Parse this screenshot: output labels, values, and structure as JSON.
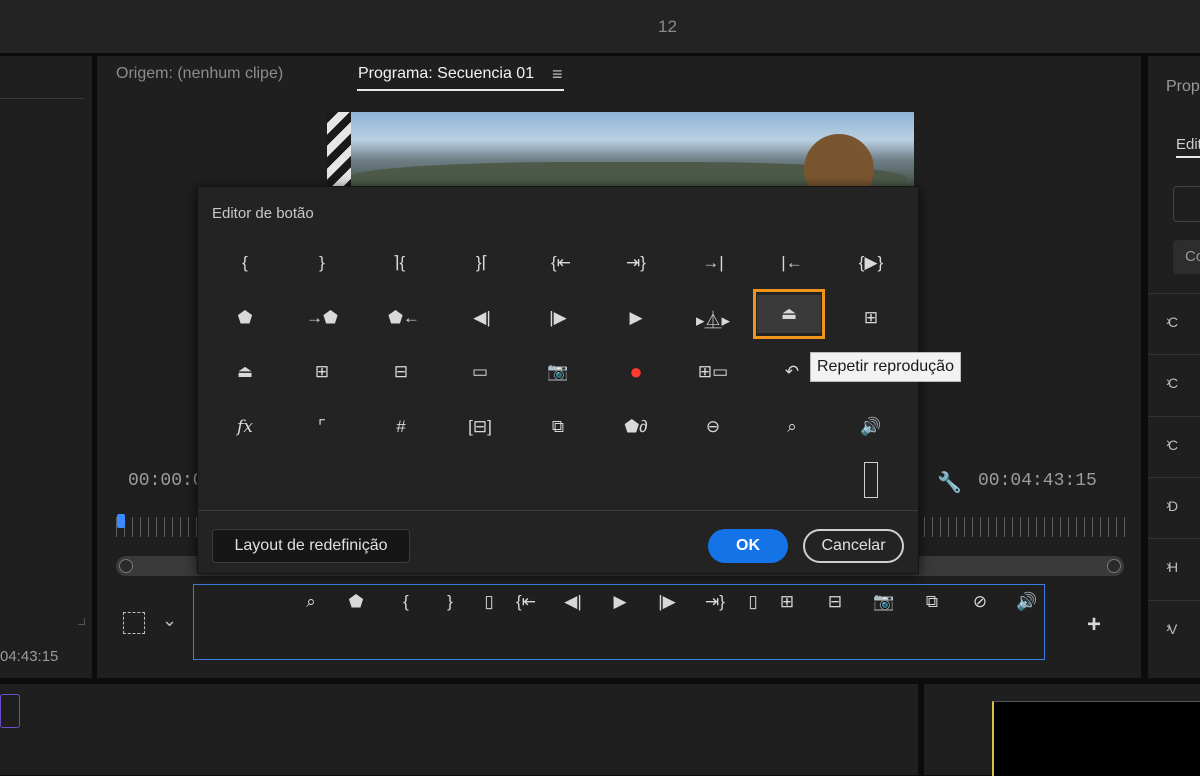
{
  "top": {
    "counter": "12"
  },
  "left_panel": {
    "timecode": "04:43:15"
  },
  "monitor": {
    "tab_source": "Origem: (nenhum clipe)",
    "tab_program": "Programa: Secuencia 01",
    "timecode_left": "00:00:0",
    "timecode_right": "00:04:43:15"
  },
  "right_panel": {
    "title": "Prop",
    "tab": "Edit",
    "button": "Co",
    "items": [
      "C",
      "C",
      "C",
      "D",
      "H",
      "V"
    ]
  },
  "dialog": {
    "title": "Editor de botão",
    "reset_label": "Layout de redefinição",
    "ok_label": "OK",
    "cancel_label": "Cancelar",
    "tooltip": "Repetir reprodução",
    "selected_icon": "loop-playback-icon",
    "icons": [
      [
        "mark-in-icon",
        "mark-out-icon",
        "clear-in-icon",
        "clear-out-icon",
        "go-to-in-icon",
        "go-to-out-icon",
        "go-to-end-icon",
        "go-to-start-icon",
        "play-in-to-out-icon"
      ],
      [
        "add-marker-icon",
        "go-to-next-marker-icon",
        "go-to-prev-marker-icon",
        "step-back-icon",
        "step-forward-icon",
        "play-icon",
        "shuttle-icon",
        "loop-playback-icon",
        "insert-icon"
      ],
      [
        "lift-icon",
        "extract-icon",
        "overwrite-icon",
        "safe-margins-icon",
        "export-frame-icon",
        "record-icon",
        "multicam-icon",
        "restore-crop-icon",
        ""
      ],
      [
        "fx-icon",
        "trim-icon",
        "grid-icon",
        "comparison-view-icon",
        "toggle-proxies-icon",
        "vr-icon",
        "rotate-icon",
        "zoom-to-fit-icon",
        "volume-icon"
      ]
    ],
    "spacer_icon": "spacer-icon"
  },
  "transport_bar": {
    "icons": [
      "zoom-to-fit-icon",
      "add-marker-icon",
      "mark-in-icon",
      "mark-out-icon",
      "spacer-icon",
      "go-to-in-icon",
      "step-back-icon",
      "play-icon",
      "step-forward-icon",
      "go-to-out-icon",
      "spacer-icon",
      "insert-icon",
      "overwrite-icon",
      "export-frame-icon",
      "toggle-proxies-icon",
      "vr-toggle-icon",
      "volume-icon"
    ]
  },
  "colors": {
    "accent": "#1473e6",
    "highlight": "#f0951c",
    "panel": "#1f1f1f"
  }
}
